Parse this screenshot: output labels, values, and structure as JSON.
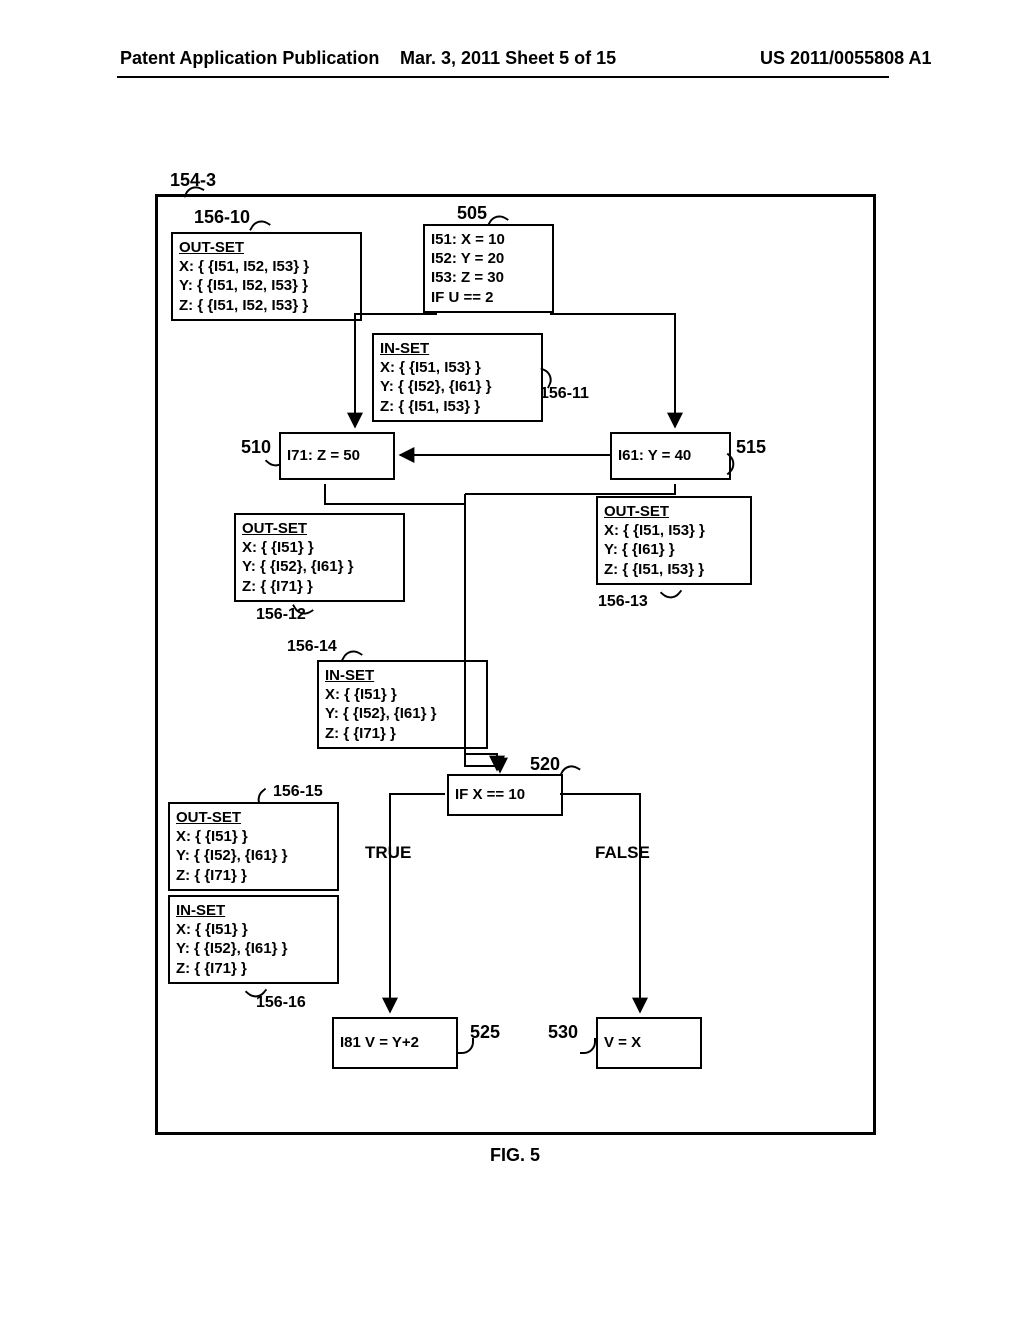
{
  "header": {
    "left": "Patent Application Publication",
    "mid": "Mar. 3, 2011  Sheet 5 of 15",
    "right": "US 2011/0055808 A1"
  },
  "figure_label": "154-3",
  "figure_caption": "FIG. 5",
  "edge_labels": {
    "true": "TRUE",
    "false": "FALSE"
  },
  "block505": {
    "ref_num": "505",
    "l1": "I51: X = 10",
    "l2": "I52: Y = 20",
    "l3": "I53: Z = 30",
    "l4": "IF U == 2"
  },
  "block510": {
    "ref_num": "510",
    "text": "I71: Z = 50"
  },
  "block515": {
    "ref_num": "515",
    "text": "I61: Y = 40"
  },
  "block520": {
    "ref_num": "520",
    "text": "IF X == 10"
  },
  "block525": {
    "ref_num": "525",
    "text": "I81 V = Y+2"
  },
  "block530": {
    "ref_num": "530",
    "text": "V = X"
  },
  "annot_156_10": {
    "ref": "156-10",
    "title": "OUT-SET",
    "x": "X: { {I51, I52, I53} }",
    "y": "Y: { {I51, I52, I53} }",
    "z": "Z: { {I51, I52, I53} }"
  },
  "annot_156_11": {
    "ref": "156-11",
    "title": "IN-SET",
    "x": "X: { {I51, I53} }",
    "y": "Y: { {I52}, {I61} }",
    "z": "Z: { {I51, I53} }"
  },
  "annot_156_12": {
    "ref": "156-12",
    "title": "OUT-SET",
    "x": "X: { {I51} }",
    "y": "Y: { {I52}, {I61} }",
    "z": "Z: { {I71} }"
  },
  "annot_156_13": {
    "ref": "156-13",
    "title": "OUT-SET",
    "x": "X: { {I51, I53} }",
    "y": "Y: { {I61} }",
    "z": "Z: { {I51, I53} }"
  },
  "annot_156_14": {
    "ref": "156-14",
    "title": "IN-SET",
    "x": "X: { {I51} }",
    "y": "Y: { {I52}, {I61} }",
    "z": "Z: { {I71} }"
  },
  "annot_156_15": {
    "ref": "156-15",
    "title": "OUT-SET",
    "x": "X: { {I51} }",
    "y": "Y: { {I52}, {I61} }",
    "z": "Z: { {I71} }"
  },
  "annot_156_16": {
    "ref": "156-16",
    "title": "IN-SET",
    "x": "X: { {I51} }",
    "y": "Y: { {I52}, {I61} }",
    "z": "Z: { {I71} }"
  }
}
